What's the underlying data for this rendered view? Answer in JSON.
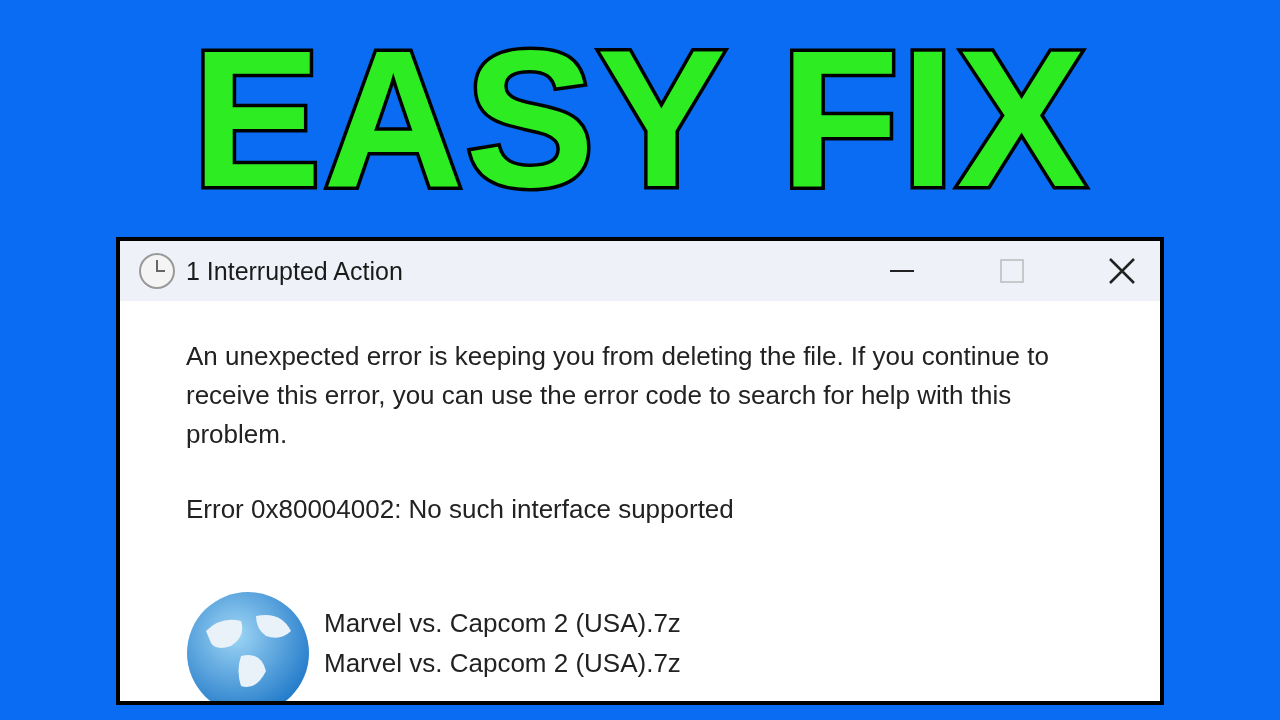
{
  "headline": "EASY FIX",
  "window": {
    "title": "1 Interrupted Action"
  },
  "message": "An unexpected error is keeping you from deleting the file. If you continue to receive this error, you can use the error code to search for help with this problem.",
  "error": "Error 0x80004002: No such interface supported",
  "files": [
    "Marvel vs. Capcom 2 (USA).7z",
    "Marvel vs. Capcom 2 (USA).7z"
  ]
}
